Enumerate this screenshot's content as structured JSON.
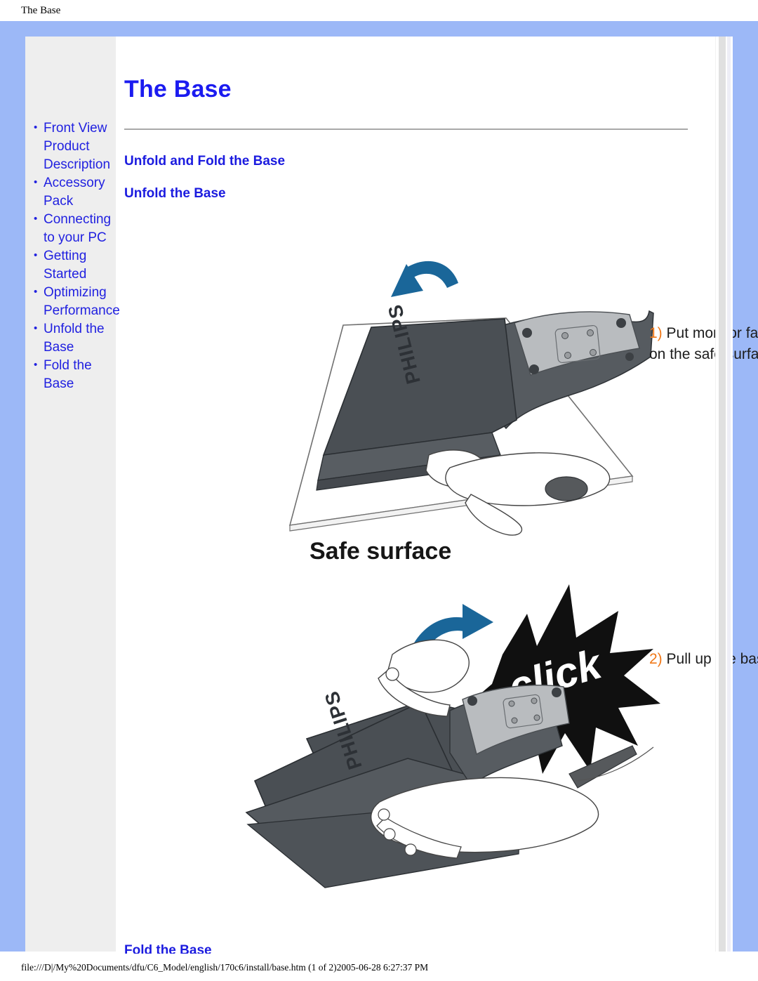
{
  "browser": {
    "header_title": "The Base",
    "footer_status": "file:///D|/My%20Documents/dfu/C6_Model/english/170c6/install/base.htm (1 of 2)2005-06-28 6:27:37 PM"
  },
  "colors": {
    "frame_blue": "#9cb8f7",
    "link_blue": "#2121e0",
    "heading_blue": "#1b1bdf",
    "step_number_orange": "#f07818",
    "arrow_blue": "#1a6699",
    "sidebar_gray": "#eeeeee"
  },
  "page": {
    "title": "The Base"
  },
  "sidebar": {
    "items": [
      {
        "label": "Front View Product Description"
      },
      {
        "label": "Accessory Pack"
      },
      {
        "label": "Connecting to your PC"
      },
      {
        "label": "Getting Started"
      },
      {
        "label": "Optimizing Performance"
      },
      {
        "label": "Unfold the Base"
      },
      {
        "label": "Fold the Base"
      }
    ]
  },
  "main": {
    "section_heading": "Unfold and Fold the Base",
    "subsection_heading": "Unfold the Base",
    "fold_heading": "Fold the Base",
    "steps": [
      {
        "number": "1)",
        "text": "Put monitor face down on the safe surface."
      },
      {
        "number": "2)",
        "text": "Pull up the base."
      }
    ],
    "illustrations": {
      "figure1": {
        "caption": "Safe surface",
        "monitor_brand": "PHILIPS",
        "arrow": "curved-arrow-left-down"
      },
      "figure2": {
        "badge": "click",
        "monitor_brand": "PHILIPS",
        "arrow": "curved-arrow-right-up"
      }
    }
  }
}
